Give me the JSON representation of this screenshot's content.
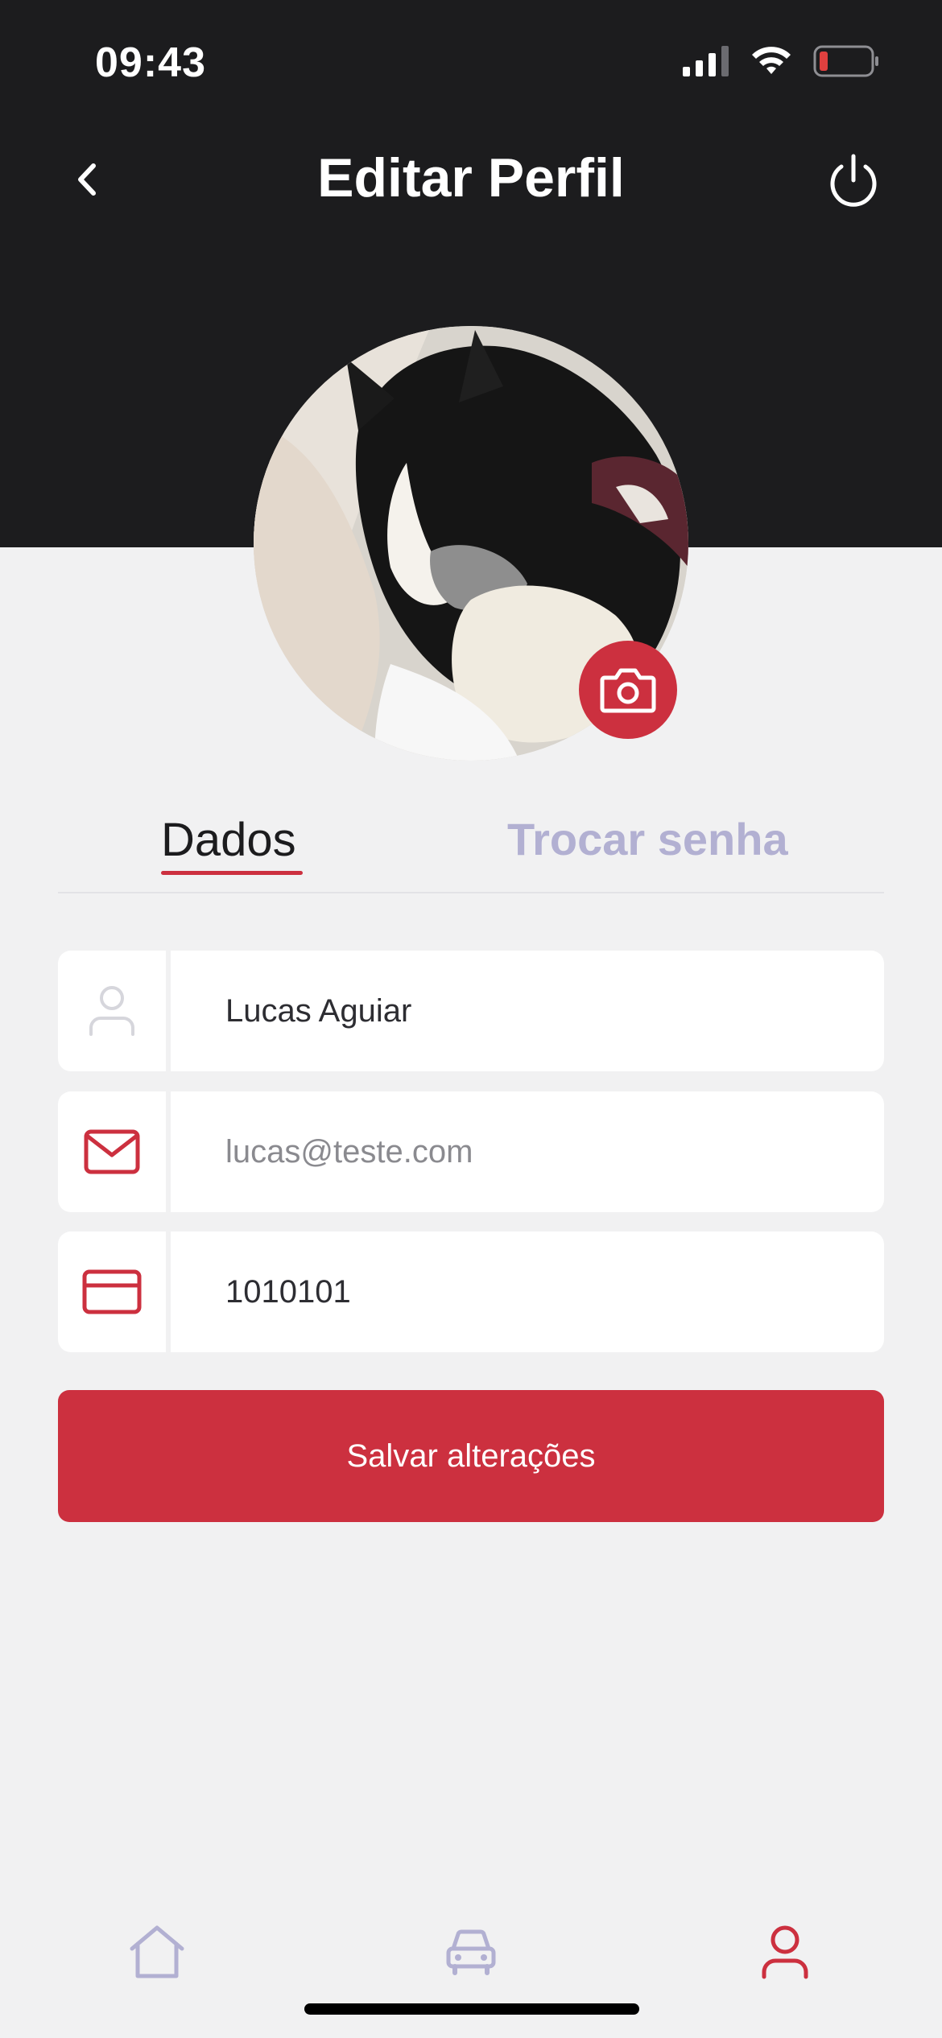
{
  "status_bar": {
    "time": "09:43"
  },
  "header": {
    "title": "Editar Perfil"
  },
  "tabs": {
    "data_label": "Dados",
    "password_label": "Trocar senha",
    "active": "Dados"
  },
  "fields": {
    "name": {
      "value": "Lucas Aguiar"
    },
    "email": {
      "placeholder": "lucas@teste.com",
      "value": ""
    },
    "id": {
      "value": "1010101"
    }
  },
  "save_button": {
    "label": "Salvar alterações"
  },
  "nav": {
    "items": [
      "home-icon",
      "car-icon",
      "profile-icon"
    ],
    "active": "profile-icon"
  },
  "colors": {
    "accent": "#cc303f",
    "header_bg": "#1c1c1e",
    "tab_inactive": "#b2b0d2",
    "background": "#f1f1f2"
  }
}
